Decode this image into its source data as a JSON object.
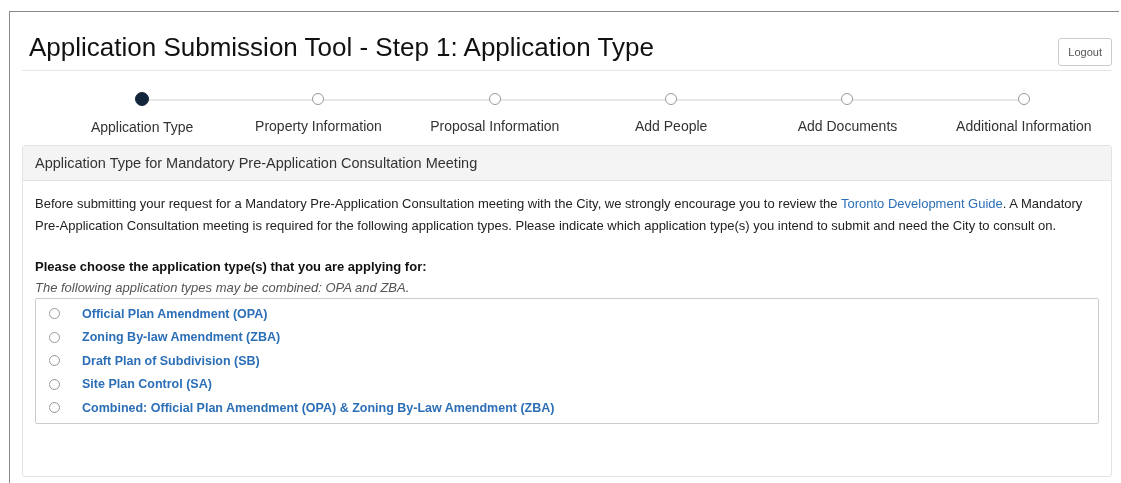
{
  "header": {
    "title": "Application Submission Tool - Step 1: Application Type",
    "logout": "Logout"
  },
  "steps": [
    {
      "label": "Application Type",
      "selected": true
    },
    {
      "label": "Property Information",
      "selected": false
    },
    {
      "label": "Proposal Information",
      "selected": false
    },
    {
      "label": "Add People",
      "selected": false
    },
    {
      "label": "Add Documents",
      "selected": false
    },
    {
      "label": "Additional Information",
      "selected": false
    }
  ],
  "panel": {
    "heading": "Application Type for Mandatory Pre-Application Consultation Meeting",
    "intro": {
      "before": "Before submitting your request for a Mandatory Pre-Application Consultation meeting with the City, we strongly encourage you to review the ",
      "link": "Toronto Development Guide",
      "after": ". A Mandatory Pre-Application Consultation meeting is required for the following application types. Please indicate which application type(s) you intend to submit and need the City to consult on."
    },
    "question": "Please choose the application type(s) that you are applying for:",
    "hint": "The following application types may be combined: OPA and ZBA.",
    "options": [
      {
        "label": "Official Plan Amendment (OPA)",
        "selected": false
      },
      {
        "label": "Zoning By-law Amendment (ZBA)",
        "selected": false
      },
      {
        "label": "Draft Plan of Subdivision (SB)",
        "selected": false
      },
      {
        "label": "Site Plan Control (SA)",
        "selected": false
      },
      {
        "label": "Combined: Official Plan Amendment (OPA) & Zoning By-Law Amendment (ZBA)",
        "selected": false
      }
    ]
  }
}
